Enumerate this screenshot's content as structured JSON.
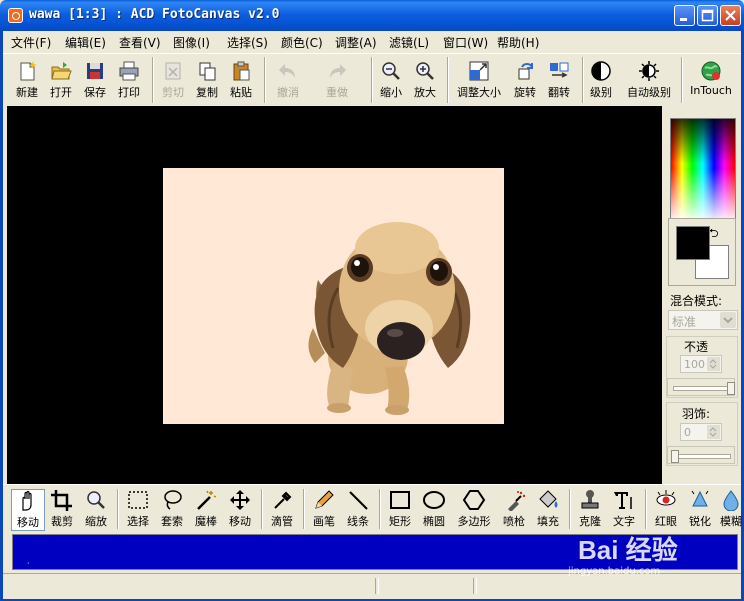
{
  "window": {
    "title": "wawa [1:3] : ACD FotoCanvas v2.0",
    "controls": [
      "minimize-icon",
      "maximize-icon",
      "close-icon"
    ]
  },
  "menu": [
    "文件(F)",
    "编辑(E)",
    "查看(V)",
    "图像(I)",
    "选择(S)",
    "颜色(C)",
    "调整(A)",
    "滤镜(L)",
    "窗口(W)",
    "帮助(H)"
  ],
  "toolbar": {
    "new": "新建",
    "open": "打开",
    "save": "保存",
    "print": "打印",
    "cut": "剪切",
    "copy": "复制",
    "paste": "粘贴",
    "undo": "撤消",
    "redo": "重做",
    "zoom_out": "缩小",
    "zoom_in": "放大",
    "resize": "调整大小",
    "rotate": "旋转",
    "flip": "翻转",
    "levels": "级别",
    "auto_levels": "自动级别",
    "intouch": "InTouch"
  },
  "panel": {
    "blend_mode_label": "混合模式:",
    "blend_mode_value": "标准",
    "opacity_label": "不透",
    "opacity_value": "100",
    "feather_label": "羽饰:",
    "feather_value": "0",
    "opacity_slider_fraction": 1.0,
    "feather_slider_fraction": 0.0,
    "foreground_color": "#000000",
    "background_color": "#ffffff"
  },
  "tools": {
    "move": "移动",
    "crop": "裁剪",
    "zoom": "缩放",
    "select": "选择",
    "lasso": "套索",
    "magic_wand": "魔棒",
    "move2": "移动",
    "eyedropper": "滴管",
    "pencil": "画笔",
    "line": "线条",
    "rectangle": "矩形",
    "ellipse": "椭圆",
    "polygon": "多边形",
    "airbrush": "喷枪",
    "fill": "填充",
    "clone": "克隆",
    "text": "文字",
    "red_eye": "红眼",
    "sharpen": "锐化",
    "blur": "模糊"
  },
  "status": {
    "text": "",
    "bar_color": "#0000c0"
  },
  "watermark": {
    "logo": "Bai 经验",
    "sub": "jingyan.baidu.com"
  },
  "canvas": {
    "background_color": "#ffe8d5"
  }
}
